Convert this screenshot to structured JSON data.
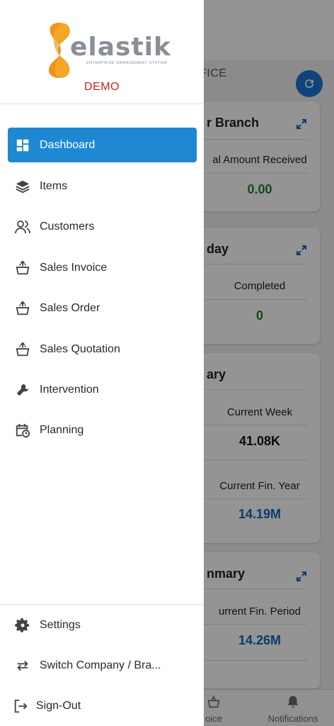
{
  "background": {
    "header_text": "FICE",
    "cards": [
      {
        "title": "r Branch",
        "label": "al Amount Received",
        "value": "0.00"
      },
      {
        "title": "day",
        "label": "Completed",
        "value": "0"
      },
      {
        "title": "ary",
        "label": "Current Week",
        "value": "41.08K",
        "label2": "Current Fin. Year",
        "value2": "14.19M"
      },
      {
        "title": "nmary",
        "label": "urrent Fin. Period",
        "value": "14.26M"
      }
    ],
    "bottom_nav": {
      "invoice_label": "oice",
      "notifications_label": "Notifications"
    }
  },
  "drawer": {
    "logo": {
      "name": "elastik",
      "tagline": "ENTERPRISE MANAGEMENT SYSTEM",
      "badge": "DEMO"
    },
    "menu": [
      {
        "label": "Dashboard",
        "icon": "dashboard-icon",
        "active": true
      },
      {
        "label": "Items",
        "icon": "layers-icon"
      },
      {
        "label": "Customers",
        "icon": "users-icon"
      },
      {
        "label": "Sales Invoice",
        "icon": "basket-icon"
      },
      {
        "label": "Sales Order",
        "icon": "basket-icon"
      },
      {
        "label": "Sales Quotation",
        "icon": "basket-icon"
      },
      {
        "label": "Intervention",
        "icon": "wrench-icon"
      },
      {
        "label": "Planning",
        "icon": "calendar-clock-icon"
      }
    ],
    "footer": [
      {
        "label": "Settings",
        "icon": "gear-icon"
      },
      {
        "label": "Switch Company / Bra...",
        "icon": "swap-icon"
      },
      {
        "label": "Sign-Out",
        "icon": "sign-out-icon"
      }
    ]
  },
  "colors": {
    "accent": "#1e88d2",
    "demo": "#c62828",
    "logo_orange": "#f5a623",
    "green_value": "#2e7d32",
    "blue_value": "#1565c0"
  }
}
